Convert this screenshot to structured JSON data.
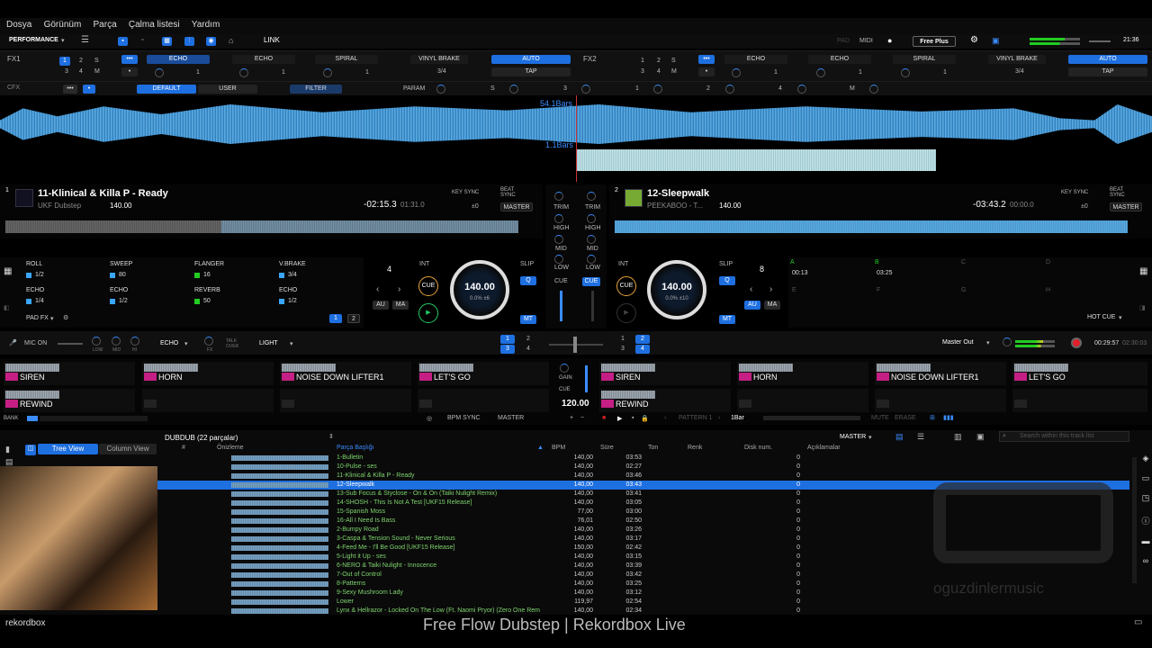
{
  "menu": [
    "Dosya",
    "Görünüm",
    "Parça",
    "Çalma listesi",
    "Yardım"
  ],
  "toolbar": {
    "mode": "PERFORMANCE",
    "link": "LINK",
    "pad": "PAD",
    "midi": "MIDI",
    "plan": "Free Plus",
    "clock": "21:36"
  },
  "fx1": {
    "label": "FX1",
    "beats": [
      "1",
      "2",
      "S",
      "3",
      "4",
      "M"
    ],
    "slots": [
      "ECHO",
      "ECHO",
      "SPIRAL"
    ],
    "values": [
      "1",
      "1",
      "1"
    ],
    "brake": "VINYL BRAKE",
    "brake_val": "3/4",
    "auto": "AUTO",
    "tap": "TAP"
  },
  "fx2": {
    "label": "FX2",
    "beats": [
      "1",
      "2",
      "S",
      "3",
      "4",
      "M"
    ],
    "slots": [
      "ECHO",
      "ECHO",
      "SPIRAL"
    ],
    "values": [
      "1",
      "1",
      "1"
    ],
    "brake": "VINYL BRAKE",
    "brake_val": "3/4",
    "auto": "AUTO",
    "tap": "TAP"
  },
  "cfx": {
    "label": "CFX",
    "default": "DEFAULT",
    "user": "USER",
    "filter": "FILTER",
    "param": "PARAM",
    "s": "S",
    "steps": [
      "3",
      "1",
      "2",
      "4"
    ],
    "m": "M"
  },
  "overview": {
    "bars1": "54.1Bars",
    "bars2": "1.1Bars"
  },
  "deck1": {
    "num": "1",
    "title": "11-Klinical & Killa P - Ready",
    "artist": "UKF Dubstep",
    "bpm": "140.00",
    "remain": "-02:15.3",
    "elapsed": "01:31.0",
    "keysync": "KEY SYNC",
    "beatsync": "BEAT SYNC",
    "key": "±0",
    "master": "MASTER",
    "pads": [
      {
        "name": "ROLL",
        "val": "1/2"
      },
      {
        "name": "SWEEP",
        "val": "80"
      },
      {
        "name": "FLANGER",
        "val": "16"
      },
      {
        "name": "V.BRAKE",
        "val": "3/4"
      },
      {
        "name": "ECHO",
        "val": "1/4"
      },
      {
        "name": "ECHO",
        "val": "1/2"
      },
      {
        "name": "REVERB",
        "val": "50"
      },
      {
        "name": "ECHO",
        "val": "1/2"
      }
    ],
    "padmode": "PAD FX",
    "page": [
      "1",
      "2"
    ],
    "beatjump": "4",
    "int": "INT",
    "cue": "CUE",
    "au": "AU",
    "ma": "MA",
    "slip": "SLIP",
    "q": "Q",
    "mt": "MT",
    "jog_bpm": "140.00",
    "jog_pitch": "0.0% ±6"
  },
  "deck2": {
    "num": "2",
    "title": "12-Sleepwalk",
    "artist": "PEEKABOO - T...",
    "bpm": "140.00",
    "remain": "-03:43.2",
    "elapsed": "00:00.0",
    "keysync": "KEY SYNC",
    "beatsync": "BEAT SYNC",
    "key": "±0",
    "master": "MASTER",
    "hotcues": [
      {
        "k": "A",
        "t": "00:13"
      },
      {
        "k": "B",
        "t": "03:25"
      },
      {
        "k": "C",
        "t": ""
      },
      {
        "k": "D",
        "t": ""
      },
      {
        "k": "E",
        "t": ""
      },
      {
        "k": "F",
        "t": ""
      },
      {
        "k": "G",
        "t": ""
      },
      {
        "k": "H",
        "t": ""
      }
    ],
    "padmode": "HOT CUE",
    "beatjump": "8",
    "int": "INT",
    "cue": "CUE",
    "au": "AU",
    "ma": "MA",
    "slip": "SLIP",
    "q": "Q",
    "mt": "MT",
    "jog_bpm": "140.00",
    "jog_pitch": "0.0% ±10"
  },
  "mixer": {
    "trim": "TRIM",
    "high": "HIGH",
    "mid": "MID",
    "low": "LOW",
    "cue": "CUE"
  },
  "mic": {
    "label": "MIC ON",
    "low": "LOW",
    "mid": "MID",
    "hi": "HI",
    "fx": "ECHO",
    "fxl": "FX",
    "talk": "TALK OVER",
    "light": "LIGHT",
    "out": "Master Out",
    "rec_time": "00:29:57",
    "rec_remain": "02:30:03"
  },
  "samplers": {
    "top": [
      "SIREN",
      "HORN",
      "NOISE DOWN LIFTER1",
      "LET'S GO",
      "SIREN",
      "HORN",
      "NOISE DOWN LIFTER1",
      "LET'S GO"
    ],
    "bottom": [
      "REWIND",
      "REWIND"
    ],
    "gain": "GAIN",
    "cue": "CUE",
    "bpm": "120.00",
    "bank": "BANK",
    "bpmsync": "BPM SYNC",
    "master": "MASTER",
    "pattern": "PATTERN 1",
    "bar": "1Bar",
    "mute": "MUTE",
    "erase": "ERASE"
  },
  "browser": {
    "playlist": "DUBDUB (22 parçalar)",
    "treeview": "Tree View",
    "columnview": "Column View",
    "master": "MASTER",
    "search": "Search within this track list",
    "columns": [
      "#",
      "Önizleme",
      "Parça Başlığı",
      "BPM",
      "Süre",
      "Ton",
      "Renk",
      "Disk num.",
      "Açıklamalar"
    ],
    "tracks": [
      {
        "no": "",
        "title": "1-Bulletin",
        "bpm": "140,00",
        "time": "03:53",
        "disk": "0"
      },
      {
        "no": "",
        "title": "10-Pulse - ses",
        "bpm": "140,00",
        "time": "02:27",
        "disk": "0"
      },
      {
        "no": "",
        "title": "11-Klinical & Killa P - Ready",
        "bpm": "140,00",
        "time": "03:46",
        "disk": "0"
      },
      {
        "no": "",
        "title": "12-Sleepwalk",
        "bpm": "140,00",
        "time": "03:43",
        "disk": "0"
      },
      {
        "no": "",
        "title": "13-Sub Focus & Styclose - On & On (Taiki Nulight Remix)",
        "bpm": "140,00",
        "time": "03:41",
        "disk": "0"
      },
      {
        "no": "",
        "title": "14-SHOSH - This Is Not A Test [UKF15 Release]",
        "bpm": "140,00",
        "time": "03:05",
        "disk": "0"
      },
      {
        "no": "",
        "title": "15-Spanish Moss",
        "bpm": "77,00",
        "time": "03:00",
        "disk": "0"
      },
      {
        "no": "",
        "title": "16-All I Need Is Bass",
        "bpm": "76,01",
        "time": "02:50",
        "disk": "0"
      },
      {
        "no": "",
        "title": "2-Bumpy Road",
        "bpm": "140,00",
        "time": "03:26",
        "disk": "0"
      },
      {
        "no": "",
        "title": "3-Caspa & Tension Sound - Never Serious",
        "bpm": "140,00",
        "time": "03:17",
        "disk": "0"
      },
      {
        "no": "",
        "title": "4-Feed Me - I'll Be Good [UKF15 Release]",
        "bpm": "150,00",
        "time": "02:42",
        "disk": "0"
      },
      {
        "no": "",
        "title": "5-Light it Up - ses",
        "bpm": "140,00",
        "time": "03:15",
        "disk": "0"
      },
      {
        "no": "",
        "title": "6-NERO & Taiki Nulight - Innocence",
        "bpm": "140,00",
        "time": "03:39",
        "disk": "0"
      },
      {
        "no": "",
        "title": "7-Out of Control",
        "bpm": "140,00",
        "time": "03:42",
        "disk": "0"
      },
      {
        "no": "",
        "title": "8-Patterns",
        "bpm": "140,00",
        "time": "03:25",
        "disk": "0"
      },
      {
        "no": "",
        "title": "9-Sexy Mushroom Lady",
        "bpm": "140,00",
        "time": "03:12",
        "disk": "0"
      },
      {
        "no": "",
        "title": "Lower",
        "bpm": "119,97",
        "time": "02:54",
        "disk": "0"
      },
      {
        "no": "",
        "title": "Lynx & Hellrazor - Locked On The Low (Ft. Naomi Pryor) (Zero One Rem",
        "bpm": "140,00",
        "time": "02:34",
        "disk": "0"
      }
    ],
    "selected_index": 3
  },
  "watermark": "oguzdinlermusic",
  "footer": {
    "logo": "rekordbox",
    "caption": "Free Flow Dubstep | Rekordbox Live"
  },
  "colors": {
    "accent": "#1e6fe0",
    "track_text": "#7fd46f",
    "sampler_tag": "#c51e84",
    "rec": "#e0202a"
  }
}
